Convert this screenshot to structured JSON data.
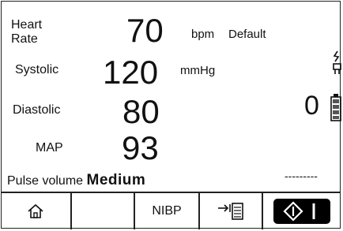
{
  "heart_rate": {
    "label_line1": "Heart",
    "label_line2": "Rate",
    "value": "70",
    "unit": "bpm",
    "mode": "Default"
  },
  "systolic": {
    "label": "Systolic",
    "value": "120",
    "unit": "mmHg"
  },
  "diastolic": {
    "label": "Diastolic",
    "value": "80"
  },
  "map": {
    "label": "MAP",
    "value": "93"
  },
  "counter": {
    "value": "0"
  },
  "pulse_volume": {
    "label": "Pulse volume",
    "value": "Medium"
  },
  "status_dashes": "---------",
  "softkeys": {
    "home_icon": "home-icon",
    "blank": "",
    "nibp_label": "NIBP",
    "export_icon": "export-to-list-icon",
    "start_stop_icon": "start-stop-icon"
  },
  "icons": {
    "connector": "power-connector-icon",
    "battery": "battery-icon"
  }
}
